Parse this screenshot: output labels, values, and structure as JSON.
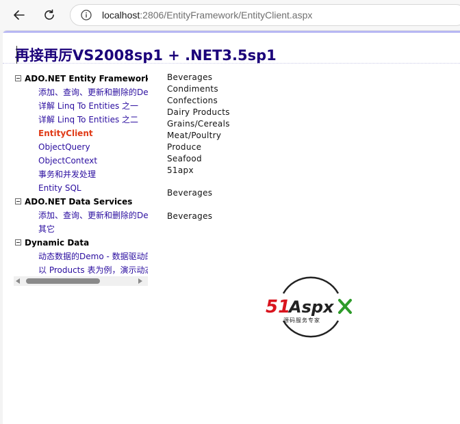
{
  "browser": {
    "url_host": "localhost",
    "url_rest": ":2806/EntityFramework/EntityClient.aspx",
    "back_icon": "back-arrow-icon",
    "refresh_icon": "refresh-icon",
    "info_icon": "info-icon"
  },
  "page": {
    "title": "再接再厉VS2008sp1 + .NET3.5sp1"
  },
  "tree": {
    "groups": [
      {
        "label": "ADO.NET Entity Framework",
        "children": [
          "添加、查询、更新和删除的De",
          "详解 Linq To Entities 之一",
          "详解 Linq To Entities 之二",
          "EntityClient",
          "ObjectQuery",
          "ObjectContext",
          "事务和并发处理",
          "Entity SQL"
        ]
      },
      {
        "label": "ADO.NET Data Services",
        "children": [
          "添加、查询、更新和删除的De",
          "其它"
        ]
      },
      {
        "label": "Dynamic Data",
        "children": [
          "动态数据的Demo - 数据驱动的",
          "以 Products 表为例，演示动态"
        ]
      }
    ],
    "selected": "EntityClient"
  },
  "categories": [
    "Beverages",
    "Condiments",
    "Confections",
    "Dairy Products",
    "Grains/Cereals",
    "Meat/Poultry",
    "Produce",
    "Seafood",
    "51apx"
  ],
  "output": {
    "line1": "Beverages",
    "line2": "Beverages"
  },
  "logo": {
    "text_51": "51",
    "text_aspx": "Aspx",
    "subtitle": "源码服务专家",
    "colors": {
      "red": "#d9141e",
      "green": "#2e9b2a",
      "dark": "#222222"
    }
  },
  "colors": {
    "title": "#1b007a",
    "link": "#2a0d9f",
    "selected": "#e03a16",
    "accent_bar": "#b7b7f3"
  }
}
